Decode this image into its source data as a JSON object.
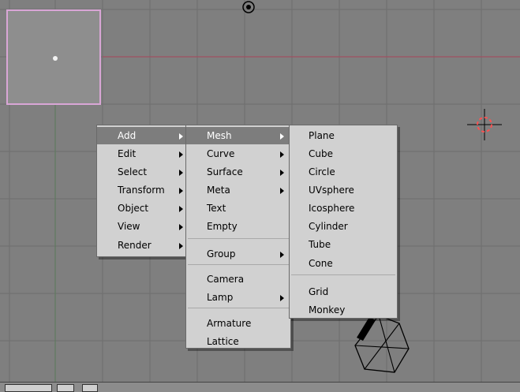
{
  "viewport": {
    "background_color": "#7f7f7f",
    "grid_color": "#6e6e6e",
    "axis_line_color": "#a05060",
    "selection_color": "#d9a6d6"
  },
  "menus": {
    "main": {
      "items": [
        {
          "label": "Add",
          "has_submenu": true,
          "active": true
        },
        {
          "label": "Edit",
          "has_submenu": true
        },
        {
          "label": "Select",
          "has_submenu": true
        },
        {
          "label": "Transform",
          "has_submenu": true
        },
        {
          "label": "Object",
          "has_submenu": true
        },
        {
          "label": "View",
          "has_submenu": true
        },
        {
          "label": "Render",
          "has_submenu": true
        }
      ]
    },
    "add": {
      "items": [
        {
          "label": "Mesh",
          "has_submenu": true,
          "active": true
        },
        {
          "label": "Curve",
          "has_submenu": true
        },
        {
          "label": "Surface",
          "has_submenu": true
        },
        {
          "label": "Meta",
          "has_submenu": true
        },
        {
          "label": "Text"
        },
        {
          "label": "Empty"
        },
        {
          "label": "Group",
          "has_submenu": true
        },
        {
          "label": "Camera"
        },
        {
          "label": "Lamp",
          "has_submenu": true
        },
        {
          "label": "Armature"
        },
        {
          "label": "Lattice"
        }
      ]
    },
    "mesh": {
      "items": [
        {
          "label": "Plane"
        },
        {
          "label": "Cube"
        },
        {
          "label": "Circle"
        },
        {
          "label": "UVsphere"
        },
        {
          "label": "Icosphere"
        },
        {
          "label": "Cylinder"
        },
        {
          "label": "Tube"
        },
        {
          "label": "Cone"
        },
        {
          "label": "Grid"
        },
        {
          "label": "Monkey"
        }
      ]
    }
  },
  "icons": {
    "cursor": "3d-cursor-icon",
    "camera": "camera-object-icon",
    "lamp": "lamp-object-icon"
  }
}
